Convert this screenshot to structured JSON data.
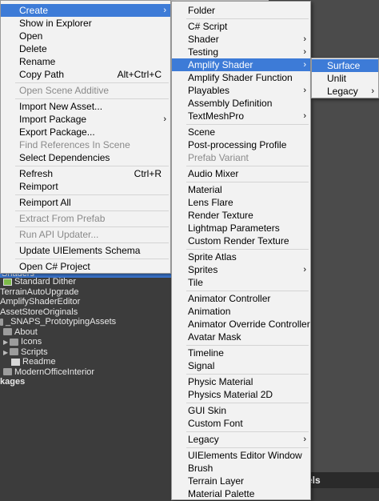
{
  "colors": {
    "highlight": "#3d7bd7",
    "menu_bg": "#f2f2f2",
    "panel_bg": "#3c3c3c"
  },
  "background": {
    "bottom_bar_text": "els",
    "tree": [
      {
        "label": "Shaders",
        "kind": "selected"
      },
      {
        "label": "Standard Dither",
        "icon": "shader-icon"
      },
      {
        "label": "TerrainAutoUpgrade"
      },
      {
        "label": "AmplifyShaderEditor"
      },
      {
        "label": "AssetStoreOriginals"
      },
      {
        "label": "_SNAPS_PrototypingAssets",
        "icon": "folder-icon"
      },
      {
        "label": "About",
        "icon": "folder-icon"
      },
      {
        "label": "Icons",
        "icon": "folder-icon",
        "expandable": true
      },
      {
        "label": "Scripts",
        "icon": "folder-icon",
        "expandable": true
      },
      {
        "label": "Readme",
        "icon": "document-icon"
      },
      {
        "label": "ModernOfficeInterior",
        "icon": "folder-icon"
      },
      {
        "label": "kages",
        "bold": true
      }
    ]
  },
  "menu1": {
    "items": [
      {
        "label": "Create",
        "submenu": true,
        "highlight": true
      },
      {
        "label": "Show in Explorer"
      },
      {
        "label": "Open"
      },
      {
        "label": "Delete"
      },
      {
        "label": "Rename"
      },
      {
        "label": "Copy Path",
        "shortcut": "Alt+Ctrl+C"
      },
      {
        "sep": true
      },
      {
        "label": "Open Scene Additive",
        "disabled": true
      },
      {
        "sep": true
      },
      {
        "label": "Import New Asset..."
      },
      {
        "label": "Import Package",
        "submenu": true
      },
      {
        "label": "Export Package..."
      },
      {
        "label": "Find References In Scene",
        "disabled": true
      },
      {
        "label": "Select Dependencies"
      },
      {
        "sep": true
      },
      {
        "label": "Refresh",
        "shortcut": "Ctrl+R"
      },
      {
        "label": "Reimport"
      },
      {
        "sep": true
      },
      {
        "label": "Reimport All"
      },
      {
        "sep": true
      },
      {
        "label": "Extract From Prefab",
        "disabled": true
      },
      {
        "sep": true
      },
      {
        "label": "Run API Updater...",
        "disabled": true
      },
      {
        "sep": true
      },
      {
        "label": "Update UIElements Schema"
      },
      {
        "sep": true
      },
      {
        "label": "Open C# Project"
      }
    ]
  },
  "menu2": {
    "items": [
      {
        "label": "Folder"
      },
      {
        "sep": true
      },
      {
        "label": "C# Script"
      },
      {
        "label": "Shader",
        "submenu": true
      },
      {
        "label": "Testing",
        "submenu": true
      },
      {
        "label": "Amplify Shader",
        "submenu": true,
        "highlight": true
      },
      {
        "label": "Amplify Shader Function"
      },
      {
        "label": "Playables",
        "submenu": true
      },
      {
        "label": "Assembly Definition"
      },
      {
        "label": "TextMeshPro",
        "submenu": true
      },
      {
        "sep": true
      },
      {
        "label": "Scene"
      },
      {
        "label": "Post-processing Profile"
      },
      {
        "label": "Prefab Variant",
        "disabled": true
      },
      {
        "sep": true
      },
      {
        "label": "Audio Mixer"
      },
      {
        "sep": true
      },
      {
        "label": "Material"
      },
      {
        "label": "Lens Flare"
      },
      {
        "label": "Render Texture"
      },
      {
        "label": "Lightmap Parameters"
      },
      {
        "label": "Custom Render Texture"
      },
      {
        "sep": true
      },
      {
        "label": "Sprite Atlas"
      },
      {
        "label": "Sprites",
        "submenu": true
      },
      {
        "label": "Tile"
      },
      {
        "sep": true
      },
      {
        "label": "Animator Controller"
      },
      {
        "label": "Animation"
      },
      {
        "label": "Animator Override Controller"
      },
      {
        "label": "Avatar Mask"
      },
      {
        "sep": true
      },
      {
        "label": "Timeline"
      },
      {
        "label": "Signal"
      },
      {
        "sep": true
      },
      {
        "label": "Physic Material"
      },
      {
        "label": "Physics Material 2D"
      },
      {
        "sep": true
      },
      {
        "label": "GUI Skin"
      },
      {
        "label": "Custom Font"
      },
      {
        "sep": true
      },
      {
        "label": "Legacy",
        "submenu": true
      },
      {
        "sep": true
      },
      {
        "label": "UIElements Editor Window"
      },
      {
        "label": "Brush"
      },
      {
        "label": "Terrain Layer"
      },
      {
        "label": "Material Palette"
      }
    ]
  },
  "menu3": {
    "items": [
      {
        "label": "Surface",
        "highlight": true
      },
      {
        "label": "Unlit"
      },
      {
        "label": "Legacy",
        "submenu": true
      }
    ]
  },
  "submenu_glyph": "›"
}
